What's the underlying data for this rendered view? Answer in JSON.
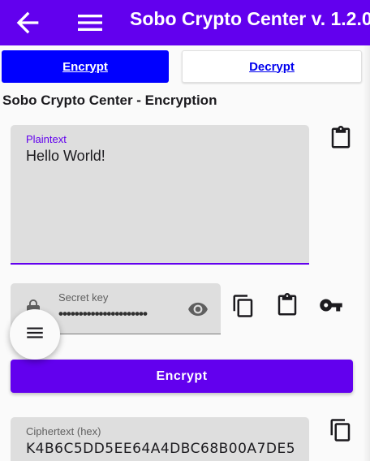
{
  "appbar": {
    "title": "Sobo Crypto Center v. 1.2.0",
    "back_icon": "arrow-back-icon",
    "menu_icon": "hamburger-menu-icon"
  },
  "tabs": [
    {
      "label": "Encrypt ",
      "selected": true
    },
    {
      "label": "Decrypt ",
      "selected": false
    }
  ],
  "section_title": "Sobo Crypto Center - Encryption",
  "plaintext": {
    "label": "Plaintext",
    "value": "Hello World!"
  },
  "secret_key": {
    "label": "Secret key",
    "value": "••••••••••••••••••••••"
  },
  "encrypt_button": {
    "label": "Encrypt"
  },
  "ciphertext": {
    "label": "Ciphertext (hex)",
    "value": "K4B6C5DD5EE64A4DBC68B00A7DE5"
  },
  "colors": {
    "primary": "#6200ee",
    "selected_tab": "#0000ff",
    "link": "#0000ee",
    "field_bg": "#dedede"
  },
  "icons": [
    "arrow-back-icon",
    "hamburger-menu-icon",
    "paste-icon",
    "lock-icon",
    "visibility-icon",
    "copy-icon",
    "key-icon"
  ]
}
